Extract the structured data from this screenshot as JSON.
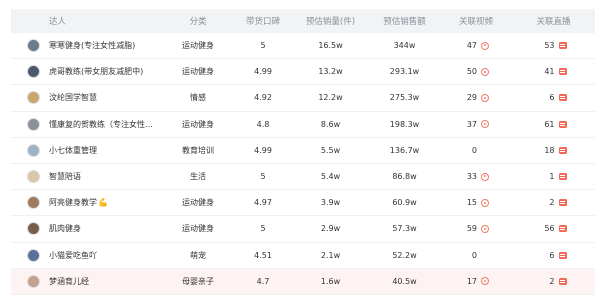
{
  "headers": {
    "creator": "达人",
    "category": "分类",
    "reputation": "带货口碑",
    "est_sales_qty": "预估销量(件)",
    "est_sales_amt": "预估销售额",
    "videos": "关联视频",
    "lives": "关联直播"
  },
  "rows": [
    {
      "name": "寒寒健身(专注女性减脂)",
      "emoji": "",
      "category": "运动健身",
      "reputation": "5",
      "sales_qty": "16.5w",
      "sales_amt": "344w",
      "videos": "47",
      "video_icon": "play-circle-icon",
      "lives": "53",
      "live_icon": "live-tv-icon",
      "avatar_color": "#6b7c8f"
    },
    {
      "name": "虎哥教练(带女朋友减肥中)",
      "emoji": "",
      "category": "运动健身",
      "reputation": "4.99",
      "sales_qty": "13.2w",
      "sales_amt": "293.1w",
      "videos": "50",
      "video_icon": "play-circle-icon",
      "lives": "41",
      "live_icon": "live-tv-icon",
      "avatar_color": "#4d5a6b"
    },
    {
      "name": "汶纶国学智慧",
      "emoji": "",
      "category": "情感",
      "reputation": "4.92",
      "sales_qty": "12.2w",
      "sales_amt": "275.3w",
      "videos": "29",
      "video_icon": "play-circle-icon",
      "lives": "6",
      "live_icon": "live-tv-icon",
      "avatar_color": "#c9a66b"
    },
    {
      "name": "懂康复的贺教练（专注女性…",
      "emoji": "",
      "category": "运动健身",
      "reputation": "4.8",
      "sales_qty": "8.6w",
      "sales_amt": "198.3w",
      "videos": "37",
      "video_icon": "play-circle-icon",
      "lives": "61",
      "live_icon": "live-tv-icon",
      "avatar_color": "#8a8f99"
    },
    {
      "name": "小七体重管理",
      "emoji": "",
      "category": "教育培训",
      "reputation": "4.99",
      "sales_qty": "5.5w",
      "sales_amt": "136.7w",
      "videos": "0",
      "video_icon": "",
      "lives": "18",
      "live_icon": "live-tv-icon",
      "avatar_color": "#9fb3c8"
    },
    {
      "name": "智慧陪语",
      "emoji": "",
      "category": "生活",
      "reputation": "5",
      "sales_qty": "5.4w",
      "sales_amt": "86.8w",
      "videos": "33",
      "video_icon": "play-circle-icon",
      "lives": "1",
      "live_icon": "live-tv-icon",
      "avatar_color": "#d8c7a8"
    },
    {
      "name": "阿亮健身教学",
      "emoji": "💪",
      "category": "运动健身",
      "reputation": "4.97",
      "sales_qty": "3.9w",
      "sales_amt": "60.9w",
      "videos": "15",
      "video_icon": "play-circle-icon",
      "lives": "2",
      "live_icon": "live-tv-icon",
      "avatar_color": "#a07a5c"
    },
    {
      "name": "肌肉健身",
      "emoji": "",
      "category": "运动健身",
      "reputation": "5",
      "sales_qty": "2.9w",
      "sales_amt": "57.3w",
      "videos": "59",
      "video_icon": "play-circle-icon",
      "lives": "56",
      "live_icon": "live-tv-icon",
      "avatar_color": "#7a5c4d"
    },
    {
      "name": "小猫爱吃鱼吖",
      "emoji": "",
      "category": "萌宠",
      "reputation": "4.51",
      "sales_qty": "2.1w",
      "sales_amt": "52.2w",
      "videos": "0",
      "video_icon": "",
      "lives": "6",
      "live_icon": "live-tv-icon",
      "avatar_color": "#5a6f9a"
    },
    {
      "name": "梦涵育儿经",
      "emoji": "",
      "category": "母婴亲子",
      "reputation": "4.7",
      "sales_qty": "1.6w",
      "sales_amt": "40.5w",
      "videos": "17",
      "video_icon": "play-circle-icon",
      "lives": "2",
      "live_icon": "live-tv-icon",
      "avatar_color": "#c7a18f"
    }
  ],
  "highlighted_row": 9,
  "colors": {
    "header_bg": "#f2f3f5",
    "accent": "#f06a55",
    "highlight_bg": "#fdf3f3"
  }
}
